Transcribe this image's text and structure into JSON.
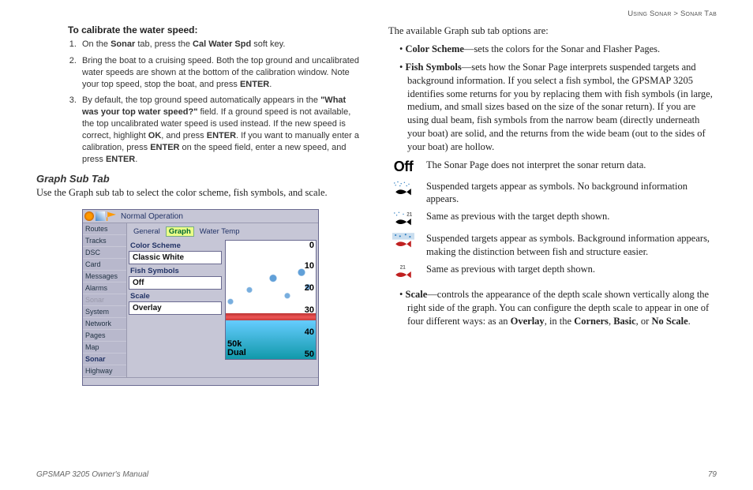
{
  "breadcrumb": {
    "section": "Using Sonar",
    "sep": " > ",
    "page": "Sonar Tab"
  },
  "left": {
    "calibrate_heading": "To calibrate the water speed:",
    "steps": {
      "s1a": "On the ",
      "s1b": "Sonar",
      "s1c": " tab, press the ",
      "s1d": "Cal Water Spd",
      "s1e": " soft key.",
      "s2a": "Bring the boat to a cruising speed. Both the top ground and uncalibrated water speeds are shown at the bottom of the calibration window. Note your top speed, stop the boat, and press ",
      "s2b": "ENTER",
      "s2c": ".",
      "s3a": "By default, the top ground speed automatically appears in the ",
      "s3b": "\"What was your top water speed?\"",
      "s3c": " field. If a ground speed is not available, the top uncalibrated water speed is used instead. If the new speed is correct, highlight ",
      "s3d": "OK",
      "s3e": ", and press ",
      "s3f": "ENTER",
      "s3g": ". If you want to manually enter a calibration, press ",
      "s3h": "ENTER",
      "s3i": " on the speed field, enter a new speed, and press ",
      "s3j": "ENTER",
      "s3k": "."
    },
    "subhead": "Graph Sub Tab",
    "subtext": "Use the Graph sub tab to select the color scheme, fish symbols, and scale.",
    "shot": {
      "title": "Normal Operation",
      "side": [
        "Routes",
        "Tracks",
        "DSC",
        "Card",
        "Messages",
        "Alarms",
        "Sonar",
        "System",
        "Network",
        "Pages",
        "Map",
        "Sonar",
        "Highway"
      ],
      "side_dim_index": 6,
      "tabs": {
        "a": "General",
        "b": "Graph",
        "c": "Water Temp"
      },
      "labels": {
        "cs": "Color Scheme",
        "fs": "Fish Symbols",
        "sc": "Scale"
      },
      "values": {
        "cs": "Classic White",
        "fs": "Off",
        "sc": "Overlay"
      },
      "depths": [
        "0",
        "10",
        "20",
        "30",
        "40",
        "50"
      ],
      "freq1": "50k",
      "freq2": "Dual"
    }
  },
  "right": {
    "intro": "The available Graph sub tab options are:",
    "b1a": "Color Scheme",
    "b1b": "—sets the colors for the Sonar and Flasher Pages.",
    "b2a": "Fish Symbols",
    "b2b": "—sets how the Sonar Page interprets suspended targets and background information. If you select a fish symbol, the GPSMAP 3205 identifies some returns for you by replacing them with fish symbols (in large, medium, and small sizes based on the size of the sonar return). If you are using dual beam, fish symbols from the narrow beam (directly underneath your boat) are solid, and the returns from the wide beam (out to the sides of your boat) are hollow.",
    "sym": {
      "off_label": "Off",
      "r1": "The Sonar Page does not interpret the sonar return data.",
      "r2": "Suspended targets appear as symbols. No background information appears.",
      "r3": "Same as previous with the target depth shown.",
      "r4": "Suspended targets appear as symbols. Background information appears, making the distinction between fish and structure easier.",
      "r5": "Same as previous with target depth shown.",
      "d21a": "21",
      "d21b": "21"
    },
    "b3a": "Scale",
    "b3b": "—controls the appearance of the depth scale shown vertically along the right side of the graph. You can configure the depth scale to appear in one of four different ways: as an ",
    "b3c": "Overlay",
    "b3d": ", in the ",
    "b3e": "Corners",
    "b3f": ", ",
    "b3g": "Basic",
    "b3h": ", or ",
    "b3i": "No Scale",
    "b3j": "."
  },
  "footer": {
    "left": "GPSMAP 3205 Owner's Manual",
    "right": "79"
  }
}
